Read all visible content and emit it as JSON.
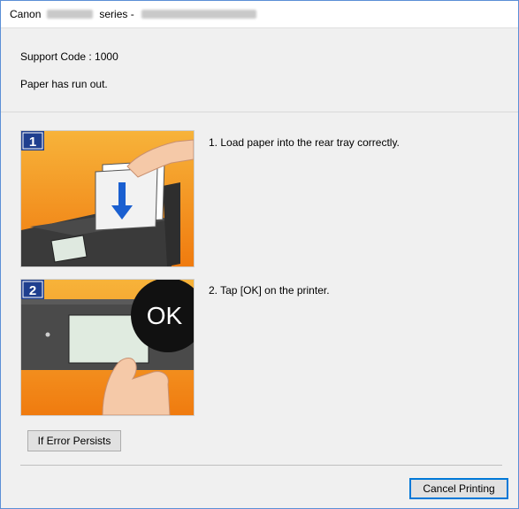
{
  "window": {
    "title_brand": "Canon",
    "title_series": "series -"
  },
  "error": {
    "support_code": "Support Code : 1000",
    "message": "Paper has run out."
  },
  "steps": [
    {
      "badge": "1",
      "text": "1.   Load paper into the rear tray correctly."
    },
    {
      "badge": "2",
      "text": "2.   Tap [OK] on the printer.",
      "screen_label": "OK"
    }
  ],
  "buttons": {
    "if_error_persists": "If Error Persists",
    "cancel_printing": "Cancel Printing"
  },
  "colors": {
    "window_border": "#5b8fd6",
    "dialog_bg": "#f0f0f0",
    "badge_blue": "#1f3f8f",
    "illustration_orange": "#f39a14"
  }
}
